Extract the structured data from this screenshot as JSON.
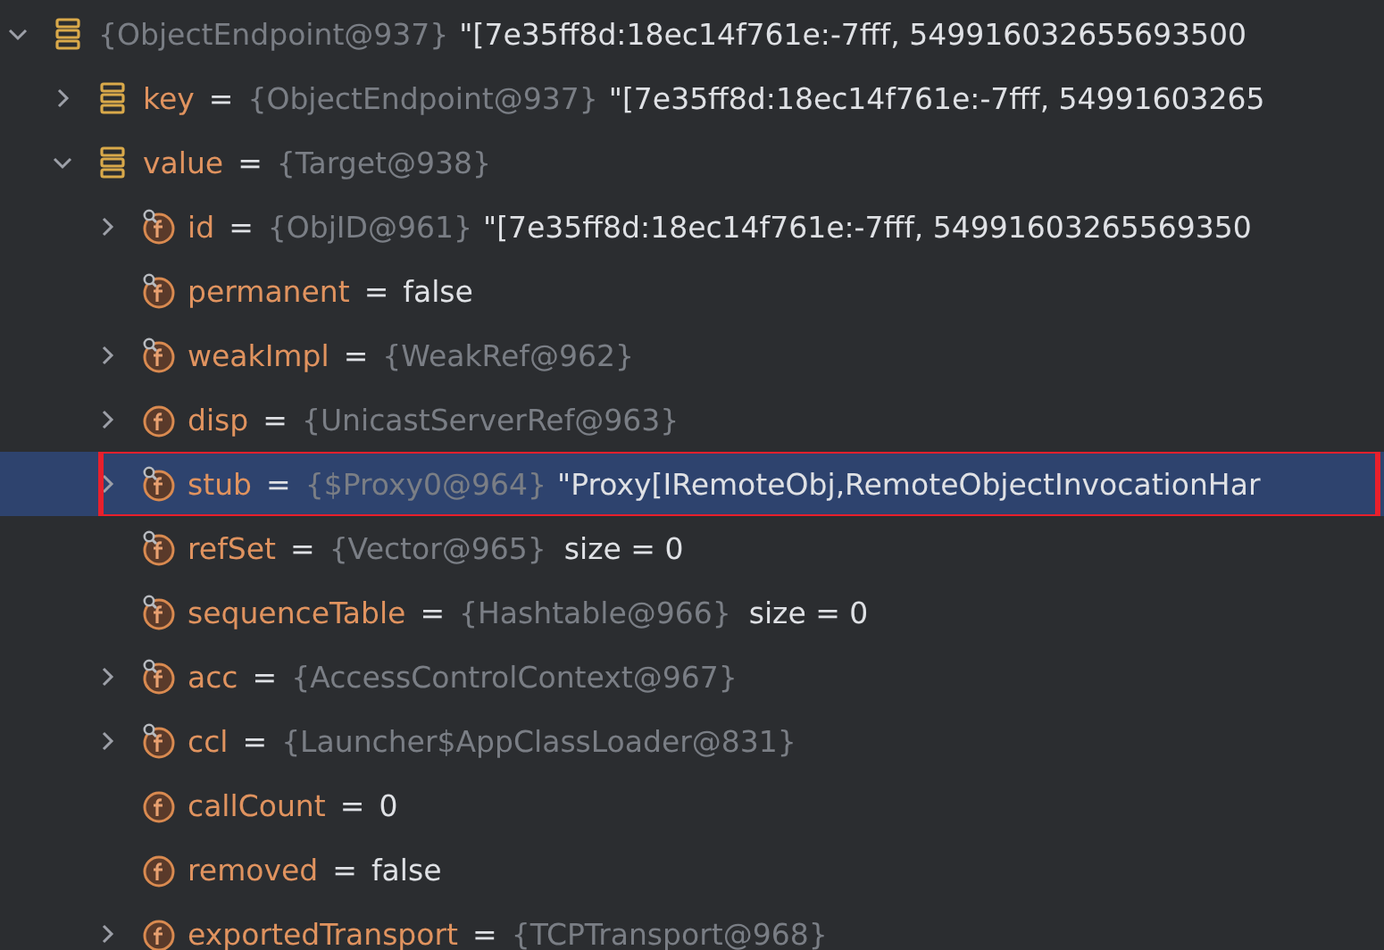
{
  "tree": [
    {
      "kind": "map",
      "expanded": true,
      "selected": false,
      "highlighted": false,
      "type": "{ObjectEndpoint@937}",
      "value": "\"[7e35ff8d:18ec14f761e:-7fff, 549916032655693500",
      "children": [
        {
          "name": "key",
          "sign": "=",
          "kind": "map",
          "expanded": false,
          "selected": false,
          "highlighted": false,
          "type": "{ObjectEndpoint@937}",
          "value": "\"[7e35ff8d:18ec14f761e:-7fff, 54991603265"
        },
        {
          "name": "value",
          "sign": "=",
          "kind": "map",
          "expanded": true,
          "selected": false,
          "highlighted": false,
          "type": "{Target@938}",
          "children": [
            {
              "name": "id",
              "sign": "=",
              "kind": "field",
              "locked": true,
              "expanded": false,
              "selected": false,
              "highlighted": false,
              "type": "{ObjID@961}",
              "value": "\"[7e35ff8d:18ec14f761e:-7fff, 54991603265569350"
            },
            {
              "name": "permanent",
              "sign": "=",
              "kind": "field",
              "locked": true,
              "selected": false,
              "highlighted": false,
              "value": "false"
            },
            {
              "name": "weakImpl",
              "sign": "=",
              "kind": "field",
              "locked": true,
              "expanded": false,
              "selected": false,
              "highlighted": false,
              "type": "{WeakRef@962}"
            },
            {
              "name": "disp",
              "sign": "=",
              "kind": "field",
              "locked": false,
              "expanded": false,
              "selected": false,
              "highlighted": false,
              "type": "{UnicastServerRef@963}"
            },
            {
              "name": "stub",
              "sign": "=",
              "kind": "field",
              "locked": true,
              "expanded": false,
              "selected": true,
              "highlighted": true,
              "type": "{$Proxy0@964}",
              "value": "\"Proxy[IRemoteObj,RemoteObjectInvocationHar"
            },
            {
              "name": "refSet",
              "sign": "=",
              "kind": "field",
              "locked": true,
              "selected": false,
              "highlighted": false,
              "type": "{Vector@965}",
              "extra": "size = 0"
            },
            {
              "name": "sequenceTable",
              "sign": "=",
              "kind": "field",
              "locked": true,
              "selected": false,
              "highlighted": false,
              "type": "{Hashtable@966}",
              "extra": "size = 0"
            },
            {
              "name": "acc",
              "sign": "=",
              "kind": "field",
              "locked": true,
              "expanded": false,
              "selected": false,
              "highlighted": false,
              "type": "{AccessControlContext@967}"
            },
            {
              "name": "ccl",
              "sign": "=",
              "kind": "field",
              "locked": true,
              "expanded": false,
              "selected": false,
              "highlighted": false,
              "type": "{Launcher$AppClassLoader@831}"
            },
            {
              "name": "callCount",
              "sign": "=",
              "kind": "field",
              "locked": false,
              "selected": false,
              "highlighted": false,
              "value": "0"
            },
            {
              "name": "removed",
              "sign": "=",
              "kind": "field",
              "locked": false,
              "selected": false,
              "highlighted": false,
              "value": "false"
            },
            {
              "name": "exportedTransport",
              "sign": "=",
              "kind": "field",
              "locked": false,
              "expanded": false,
              "selected": false,
              "highlighted": false,
              "type": "{TCPTransport@968}"
            }
          ]
        }
      ]
    }
  ]
}
